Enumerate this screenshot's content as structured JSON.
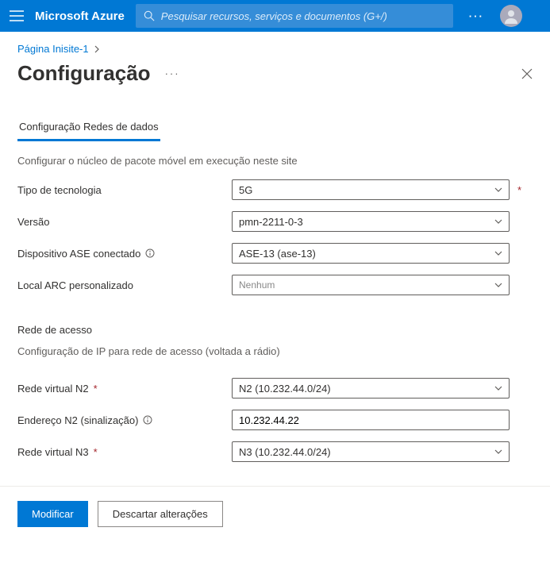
{
  "header": {
    "brand": "Microsoft Azure",
    "search_placeholder": "Pesquisar recursos, serviços e documentos (G+/)"
  },
  "breadcrumb": {
    "home": "Página Ini",
    "item": "site-1"
  },
  "page": {
    "title": "Configuração",
    "tab": "Configuração Redes de dados",
    "description": "Configurar o núcleo de pacote móvel em execução neste site"
  },
  "fields": {
    "tech_type_label": "Tipo de tecnologia",
    "tech_type_value": "5G",
    "version_label": "Versão",
    "version_value": "pmn-2211-0-3",
    "ase_label": "Dispositivo ASE conectado",
    "ase_value": "ASE-13 (ase-13)",
    "arc_label": "Local ARC personalizado",
    "arc_value": "Nenhum"
  },
  "access": {
    "section": "Rede de acesso",
    "desc": "Configuração de IP para rede de acesso (voltada a rádio)",
    "n2net_label": "Rede virtual N2",
    "n2net_value": "N2 (10.232.44.0/24)",
    "n2addr_label": "Endereço N2 (sinalização)",
    "n2addr_value": "10.232.44.22",
    "n3net_label": "Rede virtual N3",
    "n3net_value": "N3 (10.232.44.0/24)"
  },
  "footer": {
    "modify": "Modificar",
    "discard": "Descartar alterações"
  },
  "req": "*"
}
